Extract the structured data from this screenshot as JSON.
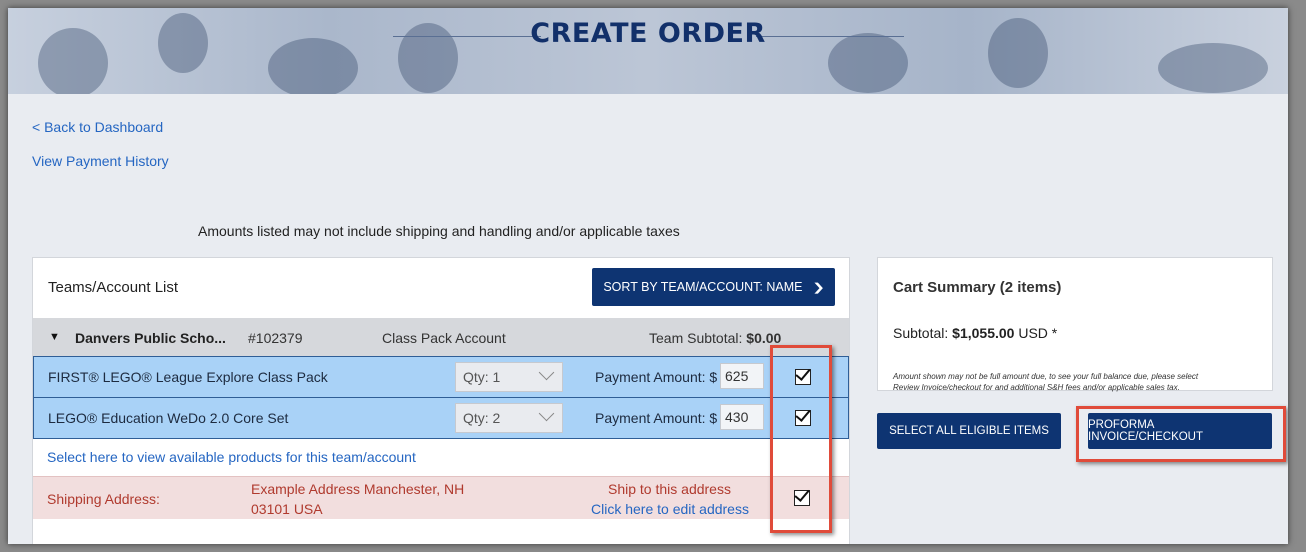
{
  "page": {
    "title": "CREATE ORDER"
  },
  "nav": {
    "back": "< Back to Dashboard",
    "history": "View Payment History"
  },
  "notice": "Amounts listed may not include shipping and handling and/or applicable taxes",
  "teams": {
    "title": "Teams/Account List",
    "sort_label": "SORT BY TEAM/ACCOUNT: NAME",
    "team": {
      "name": "Danvers Public Scho...",
      "number": "#102379",
      "type": "Class Pack Account",
      "subtotal_label": "Team Subtotal: ",
      "subtotal_value": "$0.00"
    },
    "items": [
      {
        "name": "FIRST® LEGO® League Explore Class Pack",
        "qty": "Qty: 1",
        "payment_label": "Payment Amount: $",
        "amount": "625",
        "checked": true
      },
      {
        "name": "LEGO® Education WeDo 2.0 Core Set",
        "qty": "Qty: 2",
        "payment_label": "Payment Amount: $",
        "amount": "430",
        "checked": true
      }
    ],
    "available_link": "Select here to view available products for this team/account",
    "shipping": {
      "label": "Shipping Address:",
      "address_line1": "Example Address Manchester, NH",
      "address_line2": "03101 USA",
      "ship_label": "Ship to this address",
      "edit_link": "Click here to edit address",
      "checked": true
    }
  },
  "cart": {
    "title": "Cart Summary (2 items)",
    "subtotal_label": "Subtotal: ",
    "subtotal_value": "$1,055.00",
    "subtotal_suffix": " USD *",
    "note_line1": "Amount shown may not be full amount due, to see your full balance due, please select",
    "note_line2": "Review Invoice/checkout for and additional S&H fees and/or applicable sales tax.",
    "select_all": "SELECT ALL ELIGIBLE ITEMS",
    "checkout": "PROFORMA INVOICE/CHECKOUT"
  },
  "colors": {
    "navy": "#0e3472",
    "link": "#2566c2",
    "highlight": "#e04b3a",
    "row_blue": "#a9d2f7",
    "ship_pink": "#f2dede"
  }
}
